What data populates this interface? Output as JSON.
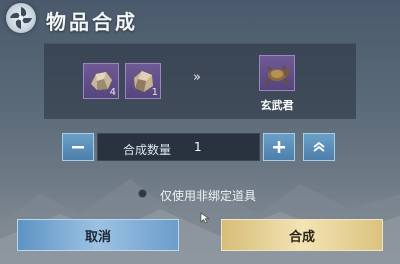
{
  "header": {
    "title": "物品合成",
    "logo_icon": "pinwheel-logo-icon"
  },
  "materials": [
    {
      "icon": "ore-stone-icon",
      "count": "4"
    },
    {
      "icon": "ore-chunk-icon",
      "count": "1"
    }
  ],
  "arrow": "»",
  "result": {
    "icon": "xuanwu-turtle-icon",
    "name": "玄武君"
  },
  "quantity": {
    "label": "合成数量",
    "value": "1"
  },
  "option": {
    "label": "仅使用非绑定道具",
    "selected": false
  },
  "buttons": {
    "cancel": "取消",
    "confirm": "合成"
  },
  "colors": {
    "slot_purple": "#6f5a95",
    "confirm_gold": "#f3e4b4",
    "cancel_blue": "#9cc2e3"
  }
}
